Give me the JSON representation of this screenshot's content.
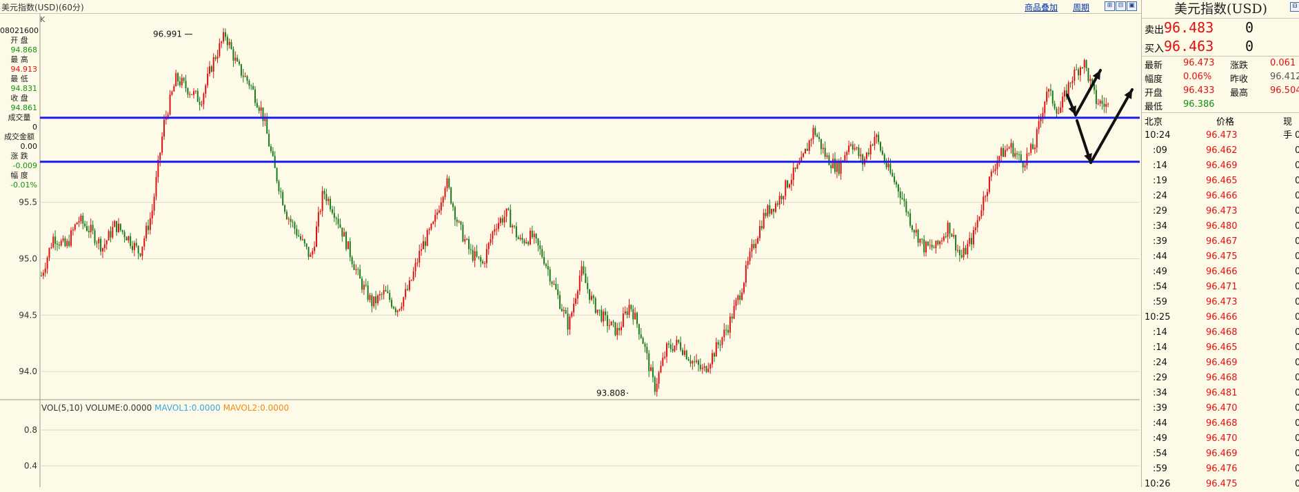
{
  "window": {
    "title": "美元指数(USD)(60分)",
    "period_marker": "K",
    "links": [
      "商品叠加",
      "周期"
    ],
    "buttons": [
      "⊞",
      "⊟",
      "▣"
    ]
  },
  "left_info": {
    "date": "08021600",
    "fields": [
      {
        "label": "开  盘",
        "value": "94.868",
        "color": "#109010"
      },
      {
        "label": "最  高",
        "value": "94.913",
        "color": "#e01010"
      },
      {
        "label": "最  低",
        "value": "94.831",
        "color": "#109010"
      },
      {
        "label": "收  盘",
        "value": "94.861",
        "color": "#109010"
      },
      {
        "label": "成交量",
        "value": "0",
        "color": "#111111"
      },
      {
        "label": "成交金额",
        "value": "0.00",
        "color": "#111111"
      },
      {
        "label": "涨  跌",
        "value": "-0.009",
        "color": "#109010"
      },
      {
        "label": "幅  度",
        "value": "-0.01%",
        "color": "#109010"
      }
    ]
  },
  "chart_data": {
    "type": "candlestick",
    "title": "美元指数(USD)(60分)",
    "ylim": [
      93.75,
      97.05
    ],
    "yticks": [
      94.0,
      94.5,
      95.0,
      95.5
    ],
    "ytick_labels": [
      "94.0",
      "94.5",
      "95.0",
      "95.5"
    ],
    "annotations": [
      {
        "text": "96.991",
        "value": 96.991,
        "kind": "high"
      },
      {
        "text": "93.808",
        "value": 93.808,
        "kind": "low"
      }
    ],
    "horizontal_lines": [
      96.25,
      95.86
    ],
    "hline_color": "#1a1aee",
    "up_color": "#e01010",
    "down_color": "#1a7a1a",
    "trend_path_close": [
      94.85,
      95.2,
      95.1,
      95.35,
      95.25,
      95.1,
      95.3,
      95.2,
      95.05,
      95.4,
      96.2,
      96.6,
      96.5,
      96.4,
      96.75,
      96.99,
      96.7,
      96.55,
      96.3,
      95.8,
      95.4,
      95.2,
      95.0,
      95.6,
      95.4,
      95.1,
      94.8,
      94.6,
      94.7,
      94.55,
      94.75,
      95.1,
      95.3,
      95.7,
      95.3,
      95.05,
      94.95,
      95.3,
      95.4,
      95.15,
      95.2,
      95.0,
      94.7,
      94.4,
      94.9,
      94.6,
      94.45,
      94.35,
      94.6,
      94.3,
      93.85,
      94.2,
      94.25,
      94.1,
      94.0,
      94.2,
      94.4,
      94.7,
      95.1,
      95.4,
      95.5,
      95.7,
      95.85,
      96.15,
      95.9,
      95.8,
      96.05,
      95.85,
      96.1,
      95.8,
      95.6,
      95.3,
      95.1,
      95.1,
      95.3,
      95.0,
      95.2,
      95.6,
      95.9,
      96.0,
      95.85,
      96.0,
      96.5,
      96.3,
      96.6,
      96.75,
      96.4,
      96.35
    ]
  },
  "volume_panel": {
    "label": "VOL(5,10) VOLUME:0.0000",
    "mavol1": "MAVOL1:0.0000",
    "mavol2": "MAVOL2:0.0000",
    "yticks": [
      "0.8",
      "0.4"
    ]
  },
  "quote": {
    "name": "美元指数(USD)",
    "sell_label": "卖出",
    "sell_price": "96.483",
    "sell_qty": "0",
    "buy_label": "买入",
    "buy_price": "96.463",
    "buy_qty": "0",
    "rows": [
      {
        "l1": "最新",
        "v1": "96.473",
        "l2": "涨跌",
        "v2": "0.061",
        "c1": "#e01010",
        "c2": "#e01010"
      },
      {
        "l1": "幅度",
        "v1": "0.06%",
        "l2": "昨收",
        "v2": "96.412",
        "c1": "#e01010",
        "c2": "#555555"
      },
      {
        "l1": "开盘",
        "v1": "96.433",
        "l2": "最高",
        "v2": "96.504",
        "c1": "#e01010",
        "c2": "#e01010"
      },
      {
        "l1": "最低",
        "v1": "96.386",
        "l2": "",
        "v2": "",
        "c1": "#109010",
        "c2": "#111111"
      }
    ]
  },
  "ticks": {
    "headers": [
      "北京",
      "价格",
      "现手"
    ],
    "rows": [
      {
        "time": "10:24",
        "price": "96.473",
        "qty": "0"
      },
      {
        "time": ":09",
        "price": "96.462",
        "qty": "0"
      },
      {
        "time": ":14",
        "price": "96.469",
        "qty": "0"
      },
      {
        "time": ":19",
        "price": "96.465",
        "qty": "0"
      },
      {
        "time": ":24",
        "price": "96.466",
        "qty": "0"
      },
      {
        "time": ":29",
        "price": "96.473",
        "qty": "0"
      },
      {
        "time": ":34",
        "price": "96.480",
        "qty": "0"
      },
      {
        "time": ":39",
        "price": "96.467",
        "qty": "0"
      },
      {
        "time": ":44",
        "price": "96.475",
        "qty": "0"
      },
      {
        "time": ":49",
        "price": "96.466",
        "qty": "0"
      },
      {
        "time": ":54",
        "price": "96.471",
        "qty": "0"
      },
      {
        "time": ":59",
        "price": "96.473",
        "qty": "0"
      },
      {
        "time": "10:25",
        "price": "96.466",
        "qty": "0"
      },
      {
        "time": ":14",
        "price": "96.468",
        "qty": "0"
      },
      {
        "time": ":14",
        "price": "96.465",
        "qty": "0"
      },
      {
        "time": ":24",
        "price": "96.469",
        "qty": "0"
      },
      {
        "time": ":29",
        "price": "96.468",
        "qty": "0"
      },
      {
        "time": ":34",
        "price": "96.481",
        "qty": "0"
      },
      {
        "time": ":39",
        "price": "96.470",
        "qty": "0"
      },
      {
        "time": ":44",
        "price": "96.468",
        "qty": "0"
      },
      {
        "time": ":49",
        "price": "96.470",
        "qty": "0"
      },
      {
        "time": ":54",
        "price": "96.469",
        "qty": "0"
      },
      {
        "time": ":59",
        "price": "96.476",
        "qty": "0"
      },
      {
        "time": "10:26",
        "price": "96.475",
        "qty": "0"
      }
    ]
  }
}
